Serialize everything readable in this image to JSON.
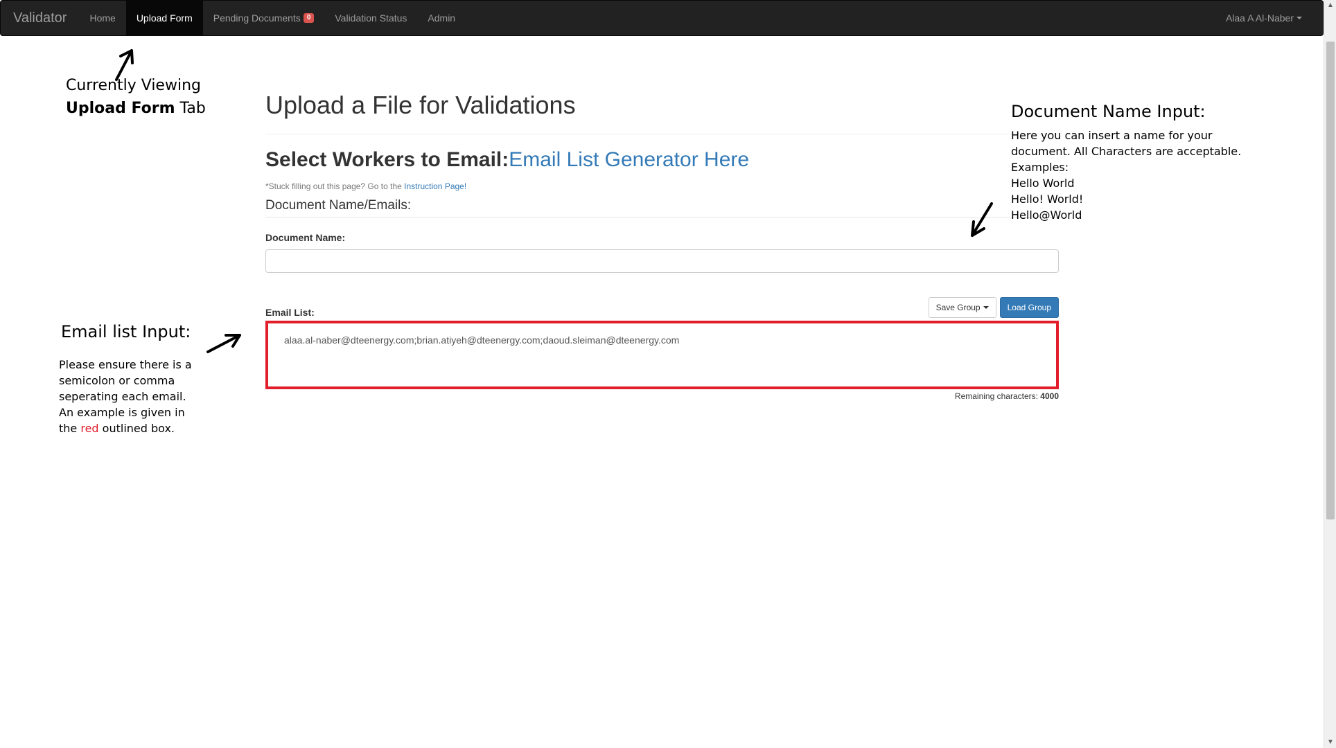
{
  "navbar": {
    "brand": "Validator",
    "items": [
      {
        "label": "Home"
      },
      {
        "label": "Upload Form"
      },
      {
        "label": "Pending Documents"
      },
      {
        "label": "Validation Status"
      },
      {
        "label": "Admin"
      }
    ],
    "pending_badge": "0",
    "user": "Alaa A Al-Naber"
  },
  "main": {
    "title": "Upload a File for Validations",
    "heading": "Select Workers to Email:",
    "heading_link": "Email List Generator Here",
    "help_text": "*Stuck filling out this page? Go to the ",
    "help_link": "Instruction Page!",
    "section_legend": "Document Name/Emails:",
    "doc_name_label": "Document Name:",
    "doc_name_value": "",
    "email_label": "Email List:",
    "save_group": "Save Group",
    "load_group": "Load Group",
    "email_value": "alaa.al-naber@dteenergy.com;brian.atiyeh@dteenergy.com;daoud.sleiman@dteenergy.com",
    "remaining_label": "Remaining characters: ",
    "remaining_count": "4000"
  },
  "annotations": {
    "tab_line1": "Currently Viewing",
    "tab_bold": "Upload Form",
    "tab_rest": " Tab",
    "doc_title": "Document Name Input:",
    "doc_lines": [
      "Here you can insert a name for your",
      "document. All Characters are acceptable.",
      "Examples:",
      "Hello World",
      "Hello! World!",
      "Hello@World"
    ],
    "email_title": "Email list Input:",
    "email_lines": [
      "Please ensure there is a",
      "semicolon or comma",
      "seperating each email.",
      "An example is given in"
    ],
    "email_last_prefix": "the ",
    "email_last_red": "red",
    "email_last_suffix": " outlined box."
  },
  "colors": {
    "navbar_bg": "#222222",
    "link": "#337ab7",
    "highlight": "#e31e2c"
  }
}
